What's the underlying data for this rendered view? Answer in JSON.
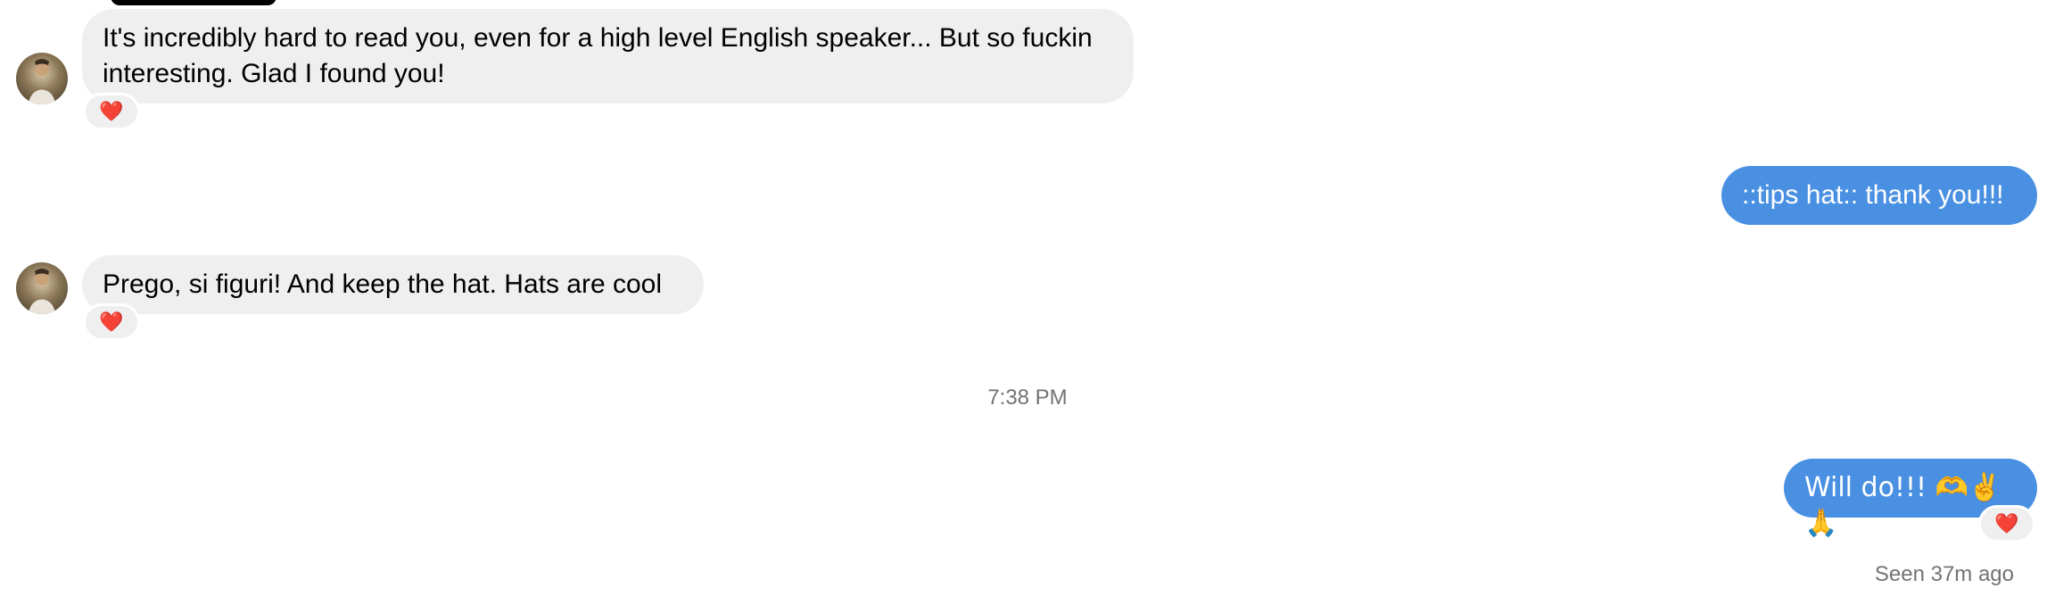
{
  "messages": [
    {
      "direction": "incoming",
      "text": "It's incredibly hard to read you, even for a high level English speaker... But so fuckin interesting. Glad I found you!",
      "reaction": "❤️"
    },
    {
      "direction": "outgoing",
      "text": "::tips hat:: thank you!!!"
    },
    {
      "direction": "incoming",
      "text": "Prego, si figuri! And keep the hat. Hats are cool",
      "reaction": "❤️"
    },
    {
      "direction": "outgoing",
      "text": "Will do!!! 🫶✌️🙏",
      "reaction": "❤️"
    }
  ],
  "timestamp": "7:38 PM",
  "seen_status": "Seen 37m ago",
  "colors": {
    "incoming_bubble": "#efefef",
    "outgoing_bubble": "#4a90e2",
    "meta_text": "#737373"
  },
  "icons": {
    "reaction": "heart-reaction-icon",
    "avatar": "user-avatar"
  }
}
